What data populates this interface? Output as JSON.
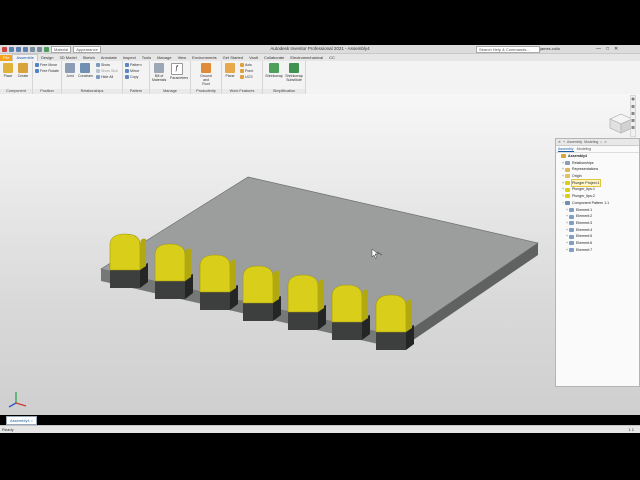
{
  "app": {
    "title": "Autodesk Inventor Professional 2021 - Assembly4",
    "search_placeholder": "Search Help & Commands...",
    "user": "james.collo",
    "quick_access_dropdowns": [
      "Material",
      "Appearance"
    ],
    "window_buttons": [
      "—",
      "□",
      "✕"
    ]
  },
  "tabs": [
    "File",
    "Assemble",
    "Design",
    "3D Model",
    "Sketch",
    "Annotate",
    "Inspect",
    "Tools",
    "Manage",
    "View",
    "Environments",
    "Get Started",
    "Vault",
    "Collaborate",
    "Electromechanical",
    "CC"
  ],
  "active_tab": "Assemble",
  "ribbon": {
    "panels": [
      {
        "label": "Component",
        "buttons": [
          "Place",
          "Create"
        ]
      },
      {
        "label": "Position",
        "buttons": [
          "Free Move",
          "Free Rotate"
        ]
      },
      {
        "label": "Relationships",
        "buttons": [
          "Joint",
          "Constrain",
          "Show",
          "Show Sick",
          "Hide All"
        ]
      },
      {
        "label": "Pattern",
        "buttons": [
          "Pattern",
          "Mirror",
          "Copy"
        ]
      },
      {
        "label": "Manage",
        "buttons": [
          "Bill of Materials",
          "Parameters"
        ]
      },
      {
        "label": "Productivity",
        "buttons": [
          "Ground and Root"
        ]
      },
      {
        "label": "Work Features",
        "buttons": [
          "Plane",
          "Axis",
          "Point",
          "UCS"
        ]
      },
      {
        "label": "Simplification",
        "buttons": [
          "Shrinkwrap",
          "Shrinkwrap Substitute"
        ]
      }
    ]
  },
  "browser": {
    "header_items": [
      "Assembly",
      "Modeling"
    ],
    "tabs": [
      "Assembly",
      "Modeling"
    ],
    "active_tab": "Assembly",
    "tree": [
      {
        "label": "Assembly4",
        "level": 0,
        "icon": "assembly-icon",
        "expand": "",
        "bold": true
      },
      {
        "label": "Relationships",
        "level": 1,
        "icon": "relationships-icon",
        "expand": "+"
      },
      {
        "label": "Representations",
        "level": 1,
        "icon": "representations-icon",
        "expand": "+"
      },
      {
        "label": "Origin",
        "level": 1,
        "icon": "origin-folder-icon",
        "expand": "+"
      },
      {
        "label": "Plunger Project:1",
        "level": 1,
        "icon": "part-icon",
        "expand": "+",
        "highlight": true
      },
      {
        "label": "Plunger_tips:1",
        "level": 1,
        "icon": "part-icon",
        "expand": "+"
      },
      {
        "label": "Plunger_tips:2",
        "level": 1,
        "icon": "part-icon",
        "expand": "+"
      },
      {
        "label": "Component Pattern 1:1",
        "level": 1,
        "icon": "pattern-icon",
        "expand": "−"
      },
      {
        "label": "Element:1",
        "level": 2,
        "icon": "element-icon",
        "expand": "+"
      },
      {
        "label": "Element:2",
        "level": 2,
        "icon": "element-icon",
        "expand": "+"
      },
      {
        "label": "Element:3",
        "level": 2,
        "icon": "element-icon",
        "expand": "+"
      },
      {
        "label": "Element:4",
        "level": 2,
        "icon": "element-icon",
        "expand": "+"
      },
      {
        "label": "Element:5",
        "level": 2,
        "icon": "element-icon",
        "expand": "+"
      },
      {
        "label": "Element:6",
        "level": 2,
        "icon": "element-icon",
        "expand": "+"
      },
      {
        "label": "Element:7",
        "level": 2,
        "icon": "element-icon",
        "expand": "+"
      }
    ]
  },
  "document_tab": "Assembly4",
  "status": {
    "text": "Ready",
    "right": "1  1"
  },
  "colors": {
    "file_tab": "#f5a21d",
    "accent": "#1b5fa8",
    "plunger_yellow": "#d9cf1a",
    "base_gray": "#8f9190"
  }
}
